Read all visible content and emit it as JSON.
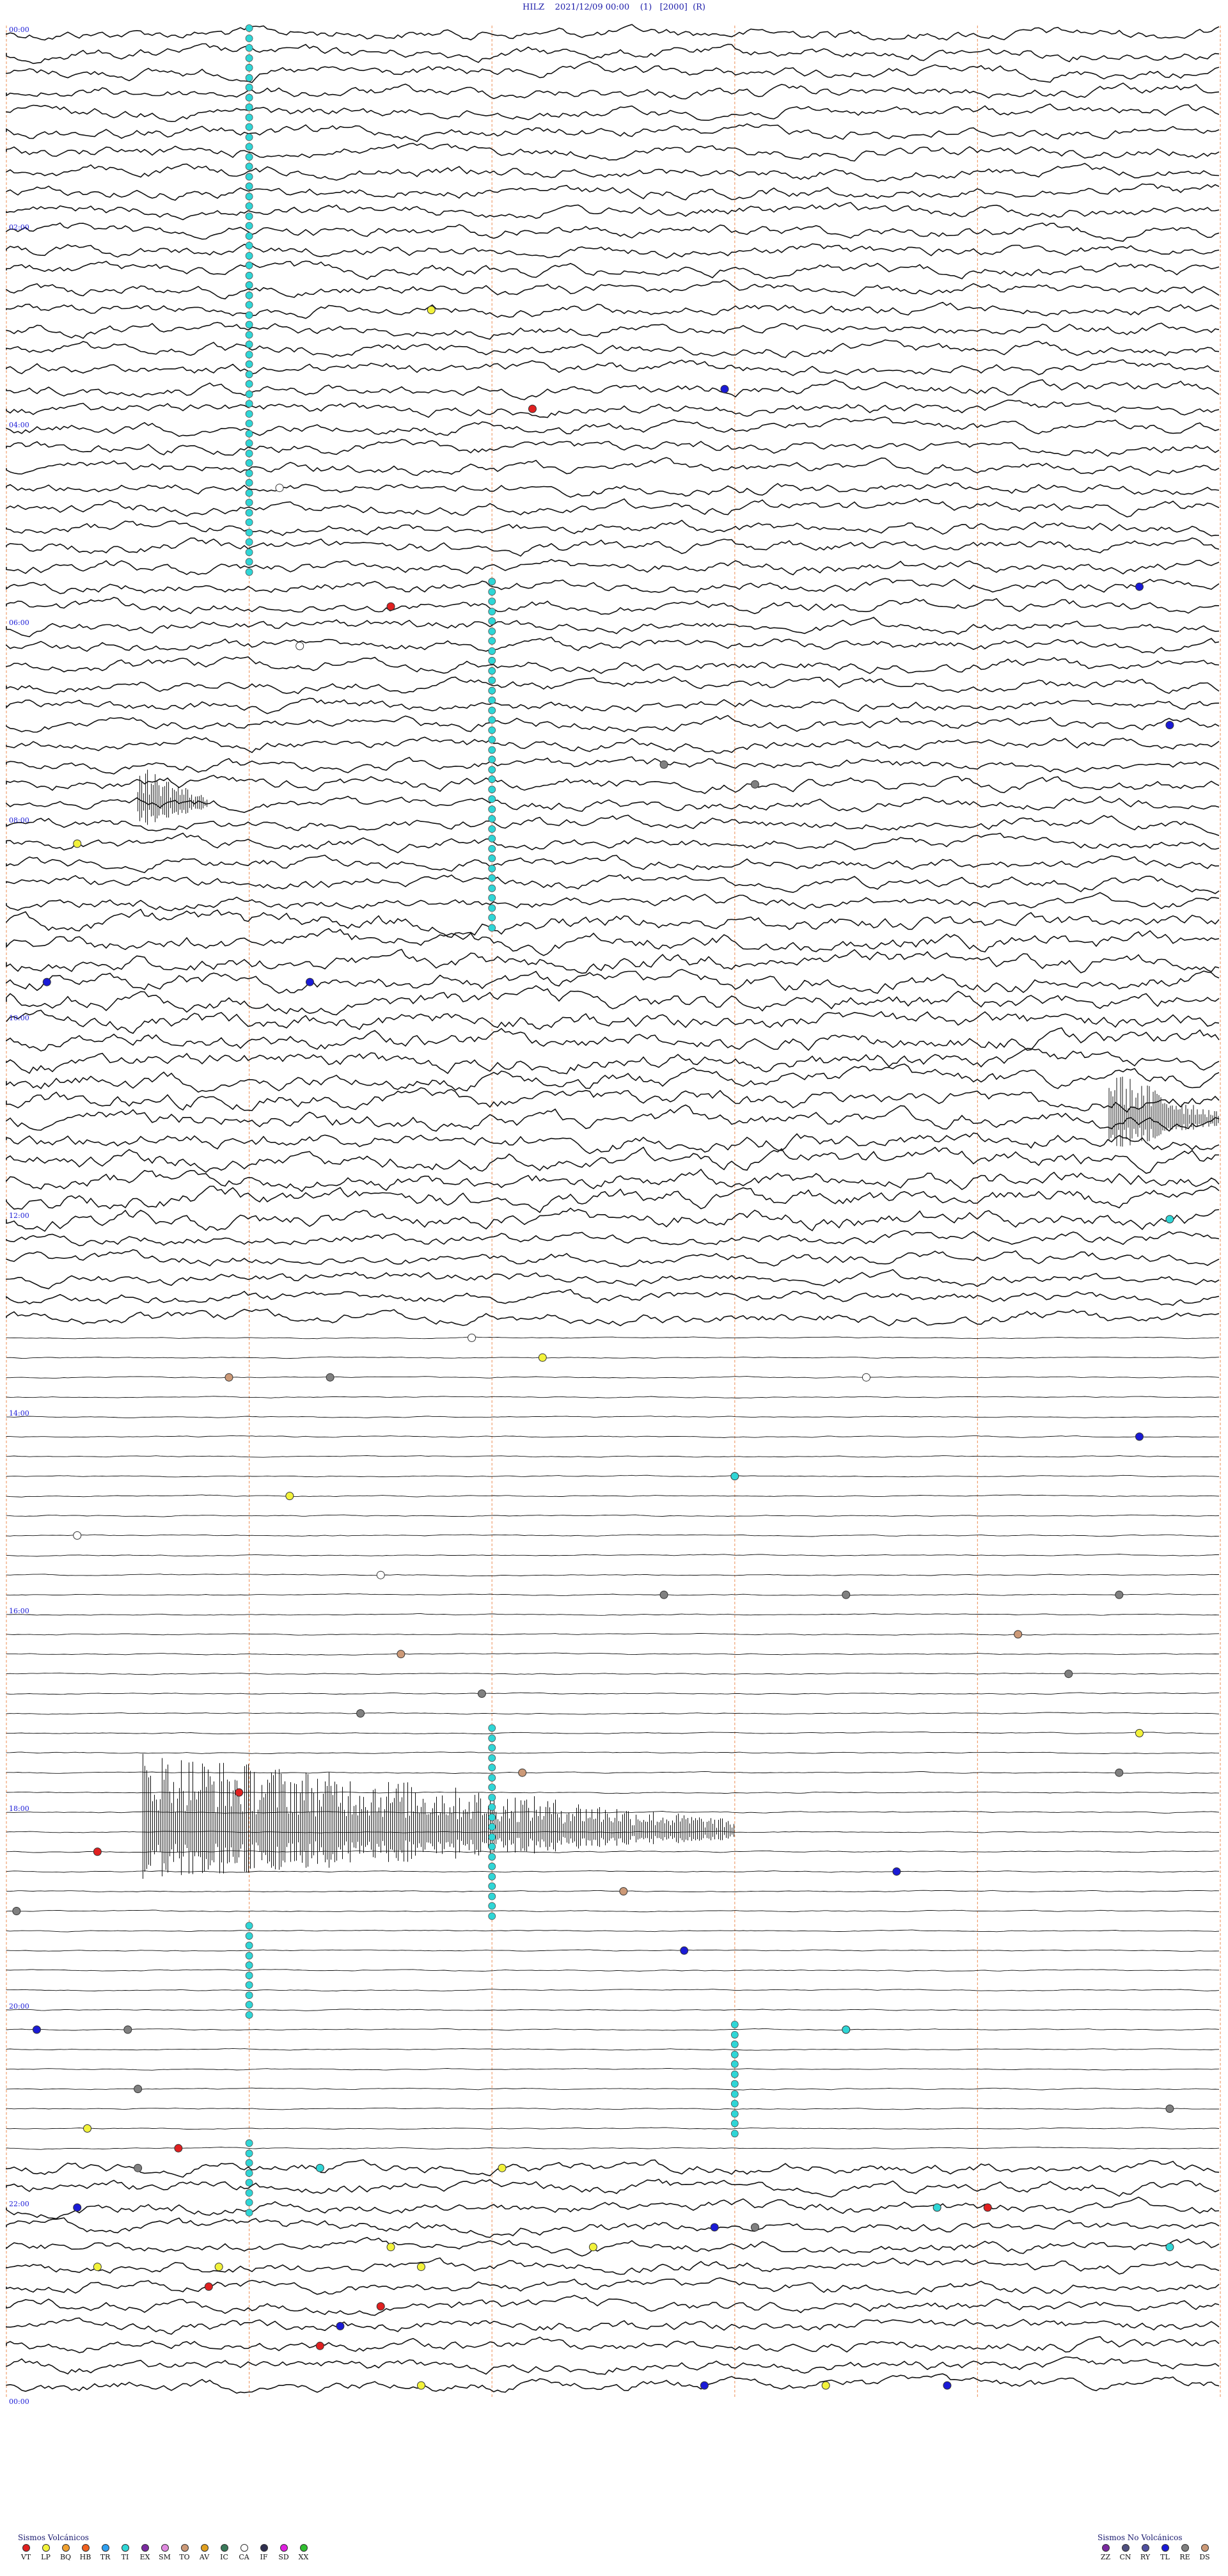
{
  "header": {
    "station": "HILZ",
    "datetime": "2021/12/09 00:00",
    "flag1": "(1)",
    "scale": "[2000]",
    "flag2": "(R)"
  },
  "chart_data": {
    "type": "line",
    "subtype": "helicorder",
    "rows": 120,
    "minutes_per_row": 12,
    "time_labels": [
      "00:00",
      "02:00",
      "04:00",
      "06:00",
      "08:00",
      "10:00",
      "12:00",
      "14:00",
      "16:00",
      "18:00",
      "20:00",
      "22:00",
      "00:00"
    ],
    "minute_gridlines": [
      0,
      2.4,
      4.8,
      7.2,
      9.6,
      12
    ],
    "noisy_row_ranges": [
      [
        0,
        66
      ],
      [
        108,
        120
      ]
    ],
    "quiet_row_ranges": [
      [
        66,
        108
      ]
    ],
    "event_columns": [
      {
        "row_start": 0,
        "row_end": 28,
        "minute": 2.4,
        "color": "#2fd6d6"
      },
      {
        "row_start": 28,
        "row_end": 46,
        "minute": 4.8,
        "color": "#2fd6d6"
      },
      {
        "row_start": 86,
        "row_end": 96,
        "minute": 4.8,
        "color": "#2fd6d6"
      },
      {
        "row_start": 96,
        "row_end": 101,
        "minute": 2.4,
        "color": "#2fd6d6"
      },
      {
        "row_start": 101,
        "row_end": 107,
        "minute": 7.2,
        "color": "#2fd6d6"
      },
      {
        "row_start": 107,
        "row_end": 111,
        "minute": 2.4,
        "color": "#2fd6d6"
      }
    ],
    "tremor_bursts": [
      {
        "row": 91,
        "minute_start": 1.35,
        "minute_end": 7.2,
        "amplitude": 1.6
      },
      {
        "row": 55,
        "minute_start": 10.9,
        "minute_end": 12,
        "amplitude": 1.0
      },
      {
        "row": 39,
        "minute_start": 1.3,
        "minute_end": 2.0,
        "amplitude": 0.8
      }
    ],
    "events": [
      {
        "row": 14,
        "minute": 4.2,
        "color": "#f2f23a"
      },
      {
        "row": 18,
        "minute": 7.1,
        "color": "#1a1ad6"
      },
      {
        "row": 19,
        "minute": 5.2,
        "color": "#e02020"
      },
      {
        "row": 23,
        "minute": 2.7,
        "color": "#ffffff"
      },
      {
        "row": 28,
        "minute": 11.2,
        "color": "#1a1ad6"
      },
      {
        "row": 29,
        "minute": 3.8,
        "color": "#e02020"
      },
      {
        "row": 31,
        "minute": 2.9,
        "color": "#ffffff"
      },
      {
        "row": 35,
        "minute": 11.5,
        "color": "#1a1ad6"
      },
      {
        "row": 37,
        "minute": 6.5,
        "color": "#808080"
      },
      {
        "row": 38,
        "minute": 7.4,
        "color": "#808080"
      },
      {
        "row": 41,
        "minute": 0.7,
        "color": "#f2f23a"
      },
      {
        "row": 48,
        "minute": 3.0,
        "color": "#1a1ad6"
      },
      {
        "row": 48,
        "minute": 0.4,
        "color": "#1a1ad6"
      },
      {
        "row": 60,
        "minute": 11.5,
        "color": "#2fd6d6"
      },
      {
        "row": 66,
        "minute": 4.6,
        "color": "#ffffff"
      },
      {
        "row": 67,
        "minute": 5.3,
        "color": "#f2f23a"
      },
      {
        "row": 68,
        "minute": 2.2,
        "color": "#cc9977"
      },
      {
        "row": 68,
        "minute": 3.2,
        "color": "#808080"
      },
      {
        "row": 68,
        "minute": 8.5,
        "color": "#ffffff"
      },
      {
        "row": 71,
        "minute": 11.2,
        "color": "#1a1ad6"
      },
      {
        "row": 73,
        "minute": 7.2,
        "color": "#2fd6d6"
      },
      {
        "row": 74,
        "minute": 2.8,
        "color": "#f2f23a"
      },
      {
        "row": 76,
        "minute": 0.7,
        "color": "#ffffff"
      },
      {
        "row": 78,
        "minute": 3.7,
        "color": "#ffffff"
      },
      {
        "row": 79,
        "minute": 6.5,
        "color": "#808080"
      },
      {
        "row": 79,
        "minute": 8.3,
        "color": "#808080"
      },
      {
        "row": 79,
        "minute": 11.0,
        "color": "#808080"
      },
      {
        "row": 81,
        "minute": 10.0,
        "color": "#cc9977"
      },
      {
        "row": 82,
        "minute": 3.9,
        "color": "#cc9977"
      },
      {
        "row": 83,
        "minute": 10.5,
        "color": "#808080"
      },
      {
        "row": 84,
        "minute": 4.7,
        "color": "#808080"
      },
      {
        "row": 85,
        "minute": 3.5,
        "color": "#808080"
      },
      {
        "row": 86,
        "minute": 11.2,
        "color": "#f2f23a"
      },
      {
        "row": 88,
        "minute": 5.1,
        "color": "#cc9977"
      },
      {
        "row": 88,
        "minute": 11.0,
        "color": "#808080"
      },
      {
        "row": 89,
        "minute": 2.3,
        "color": "#e02020"
      },
      {
        "row": 92,
        "minute": 0.9,
        "color": "#e02020"
      },
      {
        "row": 93,
        "minute": 8.8,
        "color": "#1a1ad6"
      },
      {
        "row": 94,
        "minute": 6.1,
        "color": "#cc9977"
      },
      {
        "row": 95,
        "minute": 0.1,
        "color": "#808080"
      },
      {
        "row": 97,
        "minute": 6.7,
        "color": "#1a1ad6"
      },
      {
        "row": 101,
        "minute": 0.3,
        "color": "#1a1ad6"
      },
      {
        "row": 101,
        "minute": 1.2,
        "color": "#808080"
      },
      {
        "row": 101,
        "minute": 8.3,
        "color": "#2fd6d6"
      },
      {
        "row": 104,
        "minute": 1.3,
        "color": "#808080"
      },
      {
        "row": 105,
        "minute": 11.5,
        "color": "#808080"
      },
      {
        "row": 106,
        "minute": 0.8,
        "color": "#f2f23a"
      },
      {
        "row": 107,
        "minute": 1.7,
        "color": "#e02020"
      },
      {
        "row": 108,
        "minute": 1.3,
        "color": "#808080"
      },
      {
        "row": 108,
        "minute": 4.9,
        "color": "#f2f23a"
      },
      {
        "row": 108,
        "minute": 3.1,
        "color": "#2fd6d6"
      },
      {
        "row": 110,
        "minute": 0.7,
        "color": "#1a1ad6"
      },
      {
        "row": 110,
        "minute": 9.2,
        "color": "#2fd6d6"
      },
      {
        "row": 110,
        "minute": 9.7,
        "color": "#e02020"
      },
      {
        "row": 111,
        "minute": 7.0,
        "color": "#1a1ad6"
      },
      {
        "row": 111,
        "minute": 7.4,
        "color": "#808080"
      },
      {
        "row": 112,
        "minute": 3.8,
        "color": "#f2f23a"
      },
      {
        "row": 112,
        "minute": 5.8,
        "color": "#f2f23a"
      },
      {
        "row": 112,
        "minute": 11.5,
        "color": "#2fd6d6"
      },
      {
        "row": 113,
        "minute": 0.9,
        "color": "#f2f23a"
      },
      {
        "row": 113,
        "minute": 2.1,
        "color": "#f2f23a"
      },
      {
        "row": 113,
        "minute": 4.1,
        "color": "#f2f23a"
      },
      {
        "row": 114,
        "minute": 2.0,
        "color": "#e02020"
      },
      {
        "row": 115,
        "minute": 3.7,
        "color": "#e02020"
      },
      {
        "row": 116,
        "minute": 3.3,
        "color": "#1a1ad6"
      },
      {
        "row": 117,
        "minute": 3.1,
        "color": "#e02020"
      },
      {
        "row": 119,
        "minute": 4.1,
        "color": "#f2f23a"
      },
      {
        "row": 119,
        "minute": 8.1,
        "color": "#f2f23a"
      },
      {
        "row": 119,
        "minute": 9.3,
        "color": "#1a1ad6"
      },
      {
        "row": 119,
        "minute": 6.9,
        "color": "#1a1ad6"
      }
    ],
    "colors": {
      "trace": "#111111",
      "gridline": "#f0a070",
      "time_label": "#1a1ad6"
    }
  },
  "legend": {
    "volcanic_title": "Sismos Volcánicos",
    "volcanic": [
      {
        "code": "VT",
        "color": "#e02020"
      },
      {
        "code": "LP",
        "color": "#f2f23a"
      },
      {
        "code": "BQ",
        "color": "#f0a030"
      },
      {
        "code": "HB",
        "color": "#f06020"
      },
      {
        "code": "TR",
        "color": "#2fa0f0"
      },
      {
        "code": "TI",
        "color": "#2fd6d6"
      },
      {
        "code": "EX",
        "color": "#7a2aa0"
      },
      {
        "code": "SM",
        "color": "#e08ae0"
      },
      {
        "code": "TO",
        "color": "#cc9977"
      },
      {
        "code": "AV",
        "color": "#e0a020"
      },
      {
        "code": "IC",
        "color": "#3a7a5a"
      },
      {
        "code": "CA",
        "color": "#ffffff"
      },
      {
        "code": "IF",
        "color": "#303050"
      },
      {
        "code": "SD",
        "color": "#e020e0"
      },
      {
        "code": "XX",
        "color": "#30c030"
      }
    ],
    "nonvolcanic_title": "Sismos No Volcánicos",
    "nonvolcanic": [
      {
        "code": "ZZ",
        "color": "#7a2aa0"
      },
      {
        "code": "CN",
        "color": "#505080"
      },
      {
        "code": "RY",
        "color": "#5050a0"
      },
      {
        "code": "TL",
        "color": "#1a1ad6"
      },
      {
        "code": "RE",
        "color": "#808080"
      },
      {
        "code": "DS",
        "color": "#cc9977"
      }
    ]
  }
}
